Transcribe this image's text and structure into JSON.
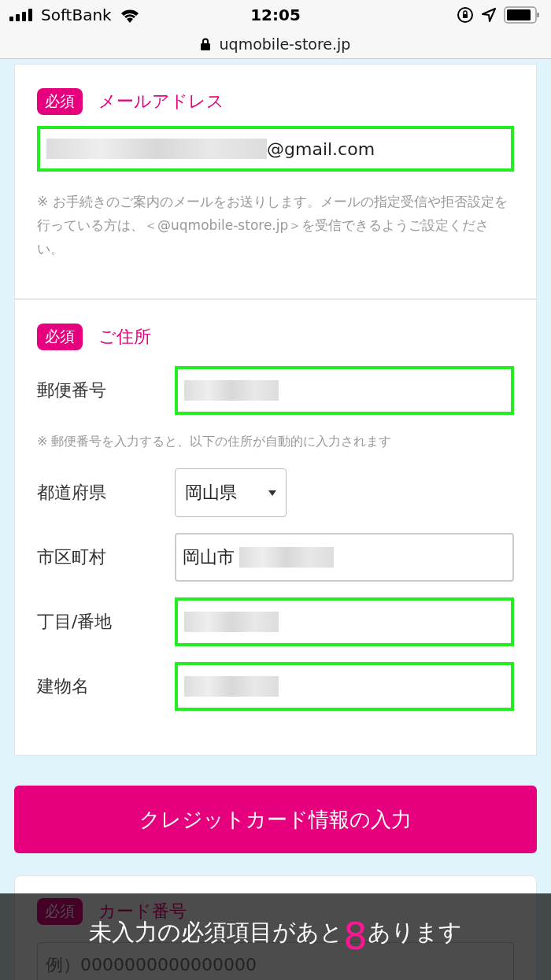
{
  "status_bar": {
    "carrier": "SoftBank",
    "time": "12:05"
  },
  "address_bar": {
    "url": "uqmobile-store.jp"
  },
  "email_section": {
    "badge": "必須",
    "title": "メールアドレス",
    "field": {
      "value": "@gmail.com",
      "redacted_before": true,
      "highlighted": true
    },
    "note": "※ お手続きのご案内のメールをお送りします。メールの指定受信や拒否設定を行っている方は、＜@uqmobile-store.jp＞を受信できるようご設定ください。"
  },
  "address_section": {
    "badge": "必須",
    "title": "ご住所",
    "fields": [
      {
        "kind": "text",
        "label": "郵便番号",
        "redacted_before": true,
        "highlighted": true
      },
      {
        "kind": "note",
        "text": "※ 郵便番号を入力すると、以下の住所が自動的に入力されます"
      },
      {
        "kind": "select",
        "label": "都道府県",
        "value": "岡山県",
        "highlighted": false
      },
      {
        "kind": "text",
        "label": "市区町村",
        "value": "岡山市",
        "redacted_after": true,
        "highlighted": false
      },
      {
        "kind": "text",
        "label": "丁目/番地",
        "redacted_before": true,
        "highlighted": true
      },
      {
        "kind": "text",
        "label": "建物名",
        "redacted_before": true,
        "highlighted": true
      }
    ]
  },
  "submit_button": "クレジットカード情報の入力",
  "card_section": {
    "badge": "必須",
    "title": "カード番号",
    "placeholder": "例）0000000000000000"
  },
  "toast": {
    "before": "未入力の必須項目があと",
    "count": "8",
    "after": "あります"
  }
}
